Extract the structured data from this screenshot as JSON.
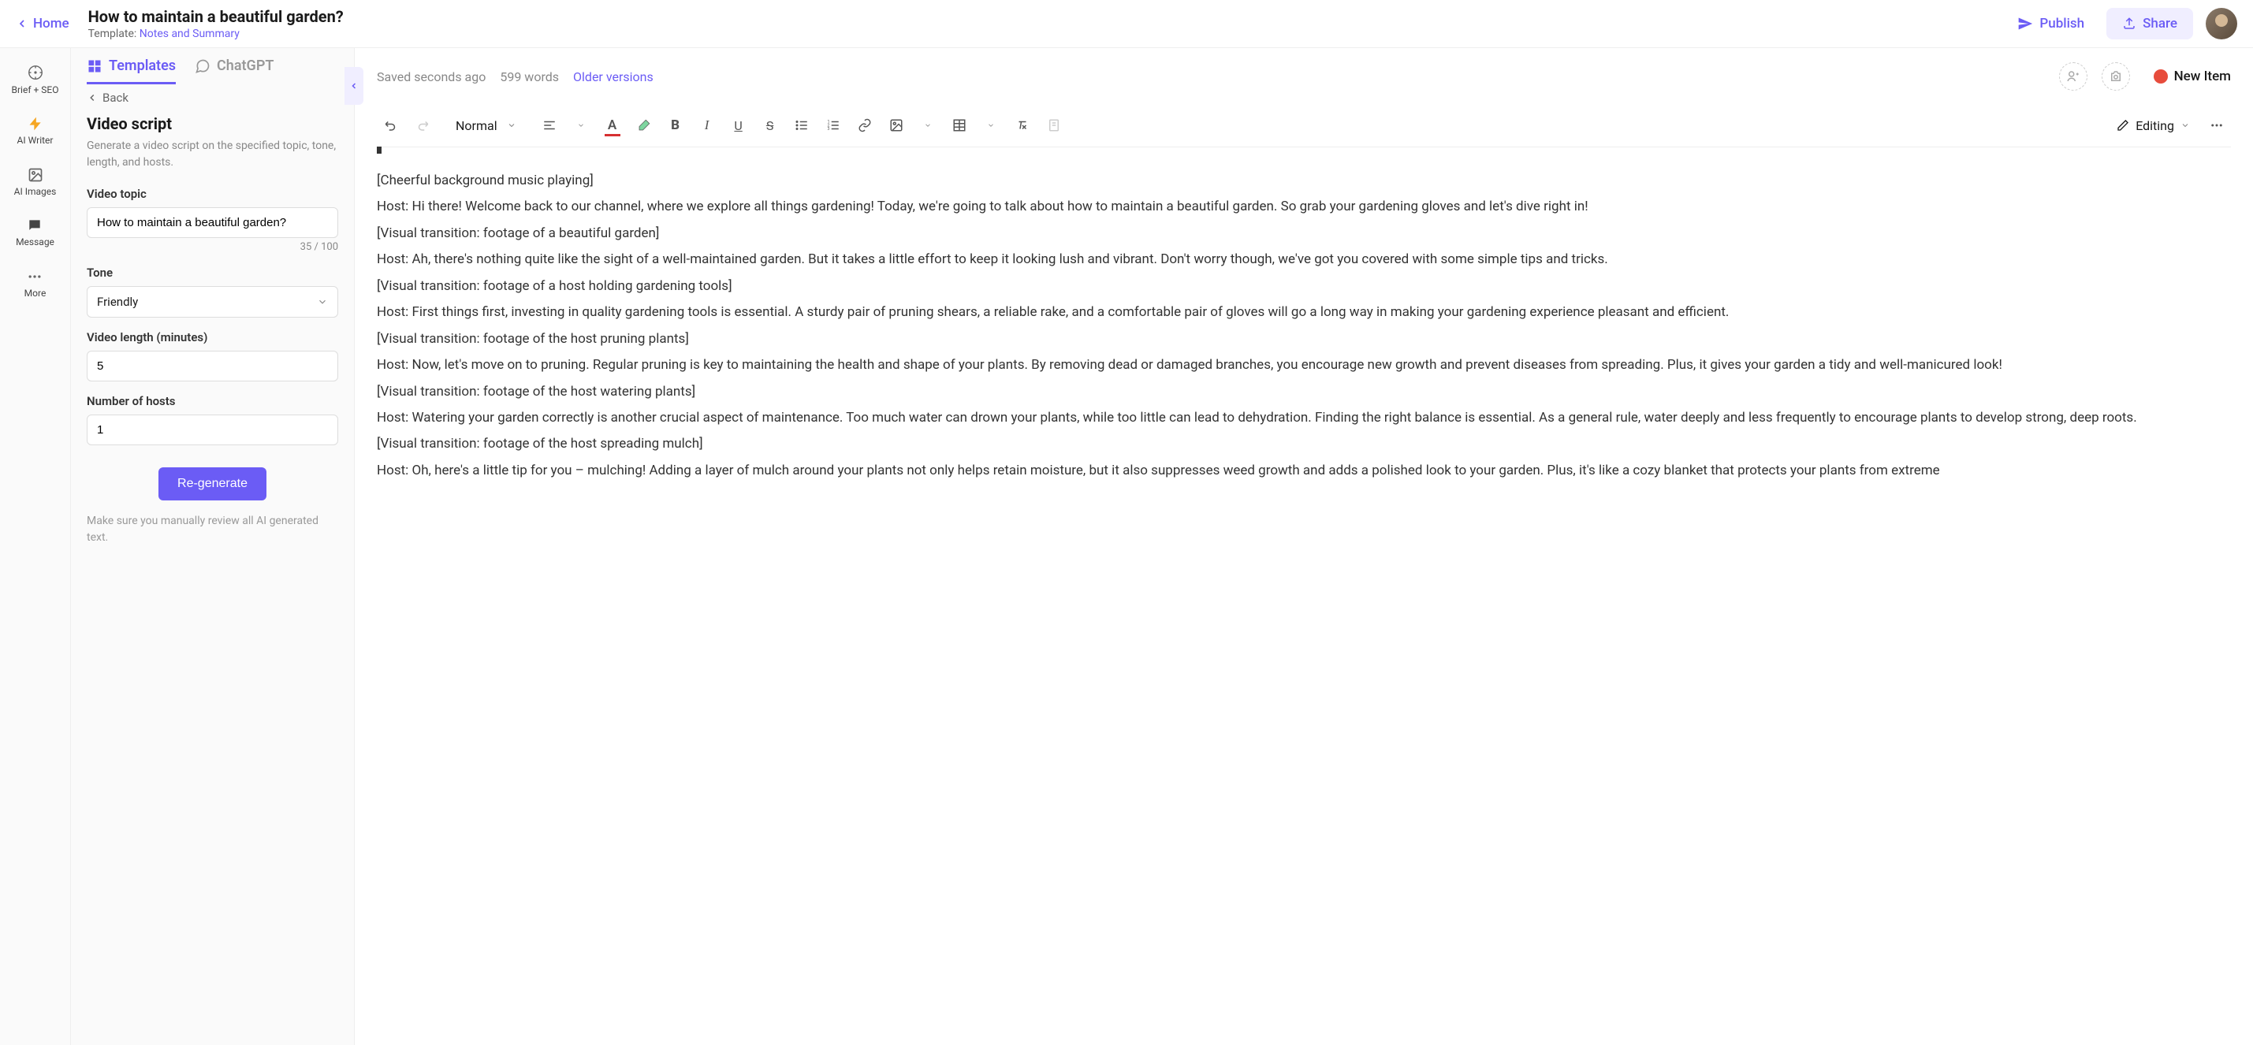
{
  "header": {
    "home": "Home",
    "title": "How to maintain a beautiful garden?",
    "template_prefix": "Template: ",
    "template_name": "Notes and Summary",
    "publish": "Publish",
    "share": "Share"
  },
  "narrow_nav": {
    "items": [
      {
        "label": "Brief + SEO"
      },
      {
        "label": "AI Writer"
      },
      {
        "label": "AI Images"
      },
      {
        "label": "Message"
      },
      {
        "label": "More"
      }
    ]
  },
  "panel": {
    "tabs": {
      "templates": "Templates",
      "chatgpt": "ChatGPT"
    },
    "back": "Back",
    "heading": "Video script",
    "desc": "Generate a video script on the specified topic, tone, length, and hosts.",
    "topic_label": "Video topic",
    "topic_value": "How to maintain a beautiful garden?",
    "char_count": "35 / 100",
    "tone_label": "Tone",
    "tone_value": "Friendly",
    "length_label": "Video length (minutes)",
    "length_value": "5",
    "hosts_label": "Number of hosts",
    "hosts_value": "1",
    "regenerate": "Re-generate",
    "review_note": "Make sure you manually review all AI generated text."
  },
  "editor_meta": {
    "saved": "Saved seconds ago",
    "words": "599 words",
    "older": "Older versions",
    "new_item": "New Item"
  },
  "toolbar": {
    "style": "Normal",
    "editing": "Editing"
  },
  "document": {
    "paragraphs": [
      "[Cheerful background music playing]",
      "Host: Hi there! Welcome back to our channel, where we explore all things gardening! Today, we're going to talk about how to maintain a beautiful garden. So grab your gardening gloves and let's dive right in!",
      "[Visual transition: footage of a beautiful garden]",
      "Host: Ah, there's nothing quite like the sight of a well-maintained garden. But it takes a little effort to keep it looking lush and vibrant. Don't worry though, we've got you covered with some simple tips and tricks.",
      "[Visual transition: footage of a host holding gardening tools]",
      "Host: First things first, investing in quality gardening tools is essential. A sturdy pair of pruning shears, a reliable rake, and a comfortable pair of gloves will go a long way in making your gardening experience pleasant and efficient.",
      "[Visual transition: footage of the host pruning plants]",
      "Host: Now, let's move on to pruning. Regular pruning is key to maintaining the health and shape of your plants. By removing dead or damaged branches, you encourage new growth and prevent diseases from spreading. Plus, it gives your garden a tidy and well-manicured look!",
      "[Visual transition: footage of the host watering plants]",
      "Host: Watering your garden correctly is another crucial aspect of maintenance. Too much water can drown your plants, while too little can lead to dehydration. Finding the right balance is essential. As a general rule, water deeply and less frequently to encourage plants to develop strong, deep roots.",
      "[Visual transition: footage of the host spreading mulch]",
      "Host: Oh, here's a little tip for you – mulching! Adding a layer of mulch around your plants not only helps retain moisture, but it also suppresses weed growth and adds a polished look to your garden. Plus, it's like a cozy blanket that protects your plants from extreme"
    ]
  }
}
